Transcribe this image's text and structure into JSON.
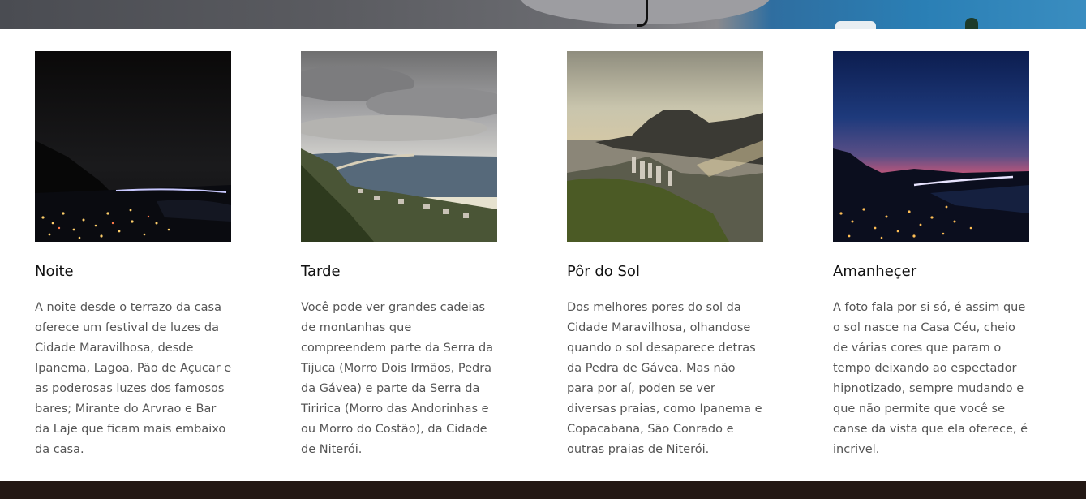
{
  "cards": [
    {
      "title": "Noite",
      "photo": "night-city-photo",
      "text": "A noite desde o terrazo da casa oferece um festival de luzes da Cidade Maravilhosa, desde Ipanema, Lagoa, Pão de Açucar e as poderosas luzes dos famosos bares; Mirante do Arvrao e Bar da Laje que ficam mais embaixo da casa."
    },
    {
      "title": "Tarde",
      "photo": "afternoon-coast-photo",
      "text": "Você pode ver grandes cadeias de montanhas que compreendem parte da Serra da Tijuca (Morro Dois Irmãos, Pedra da Gávea) e parte da Serra da Tiririca (Morro das Andorinhas e ou Morro do Costão), da Cidade de Niterói."
    },
    {
      "title": "Pôr do Sol",
      "photo": "sunset-mountain-photo",
      "text": "Dos melhores pores do sol da Cidade Maravilhosa, olhandose quando o sol desaparece detras da Pedra de Gávea. Mas não para por aí, poden se ver diversas praias, como Ipanema e Copacabana, São Conrado e outras praias de Niterói."
    },
    {
      "title": "Amanheçer",
      "photo": "dawn-sky-photo",
      "text": "A foto fala por si só, é assim que o sol nasce na Casa Céu, cheio de várias cores que param o tempo deixando ao espectador hipnotizado, sempre mudando e que não permite que você se canse da vista que ela oferece, é incrivel."
    }
  ],
  "colors": {
    "footer": "#231814",
    "title": "#111111",
    "body_text": "#555555"
  }
}
